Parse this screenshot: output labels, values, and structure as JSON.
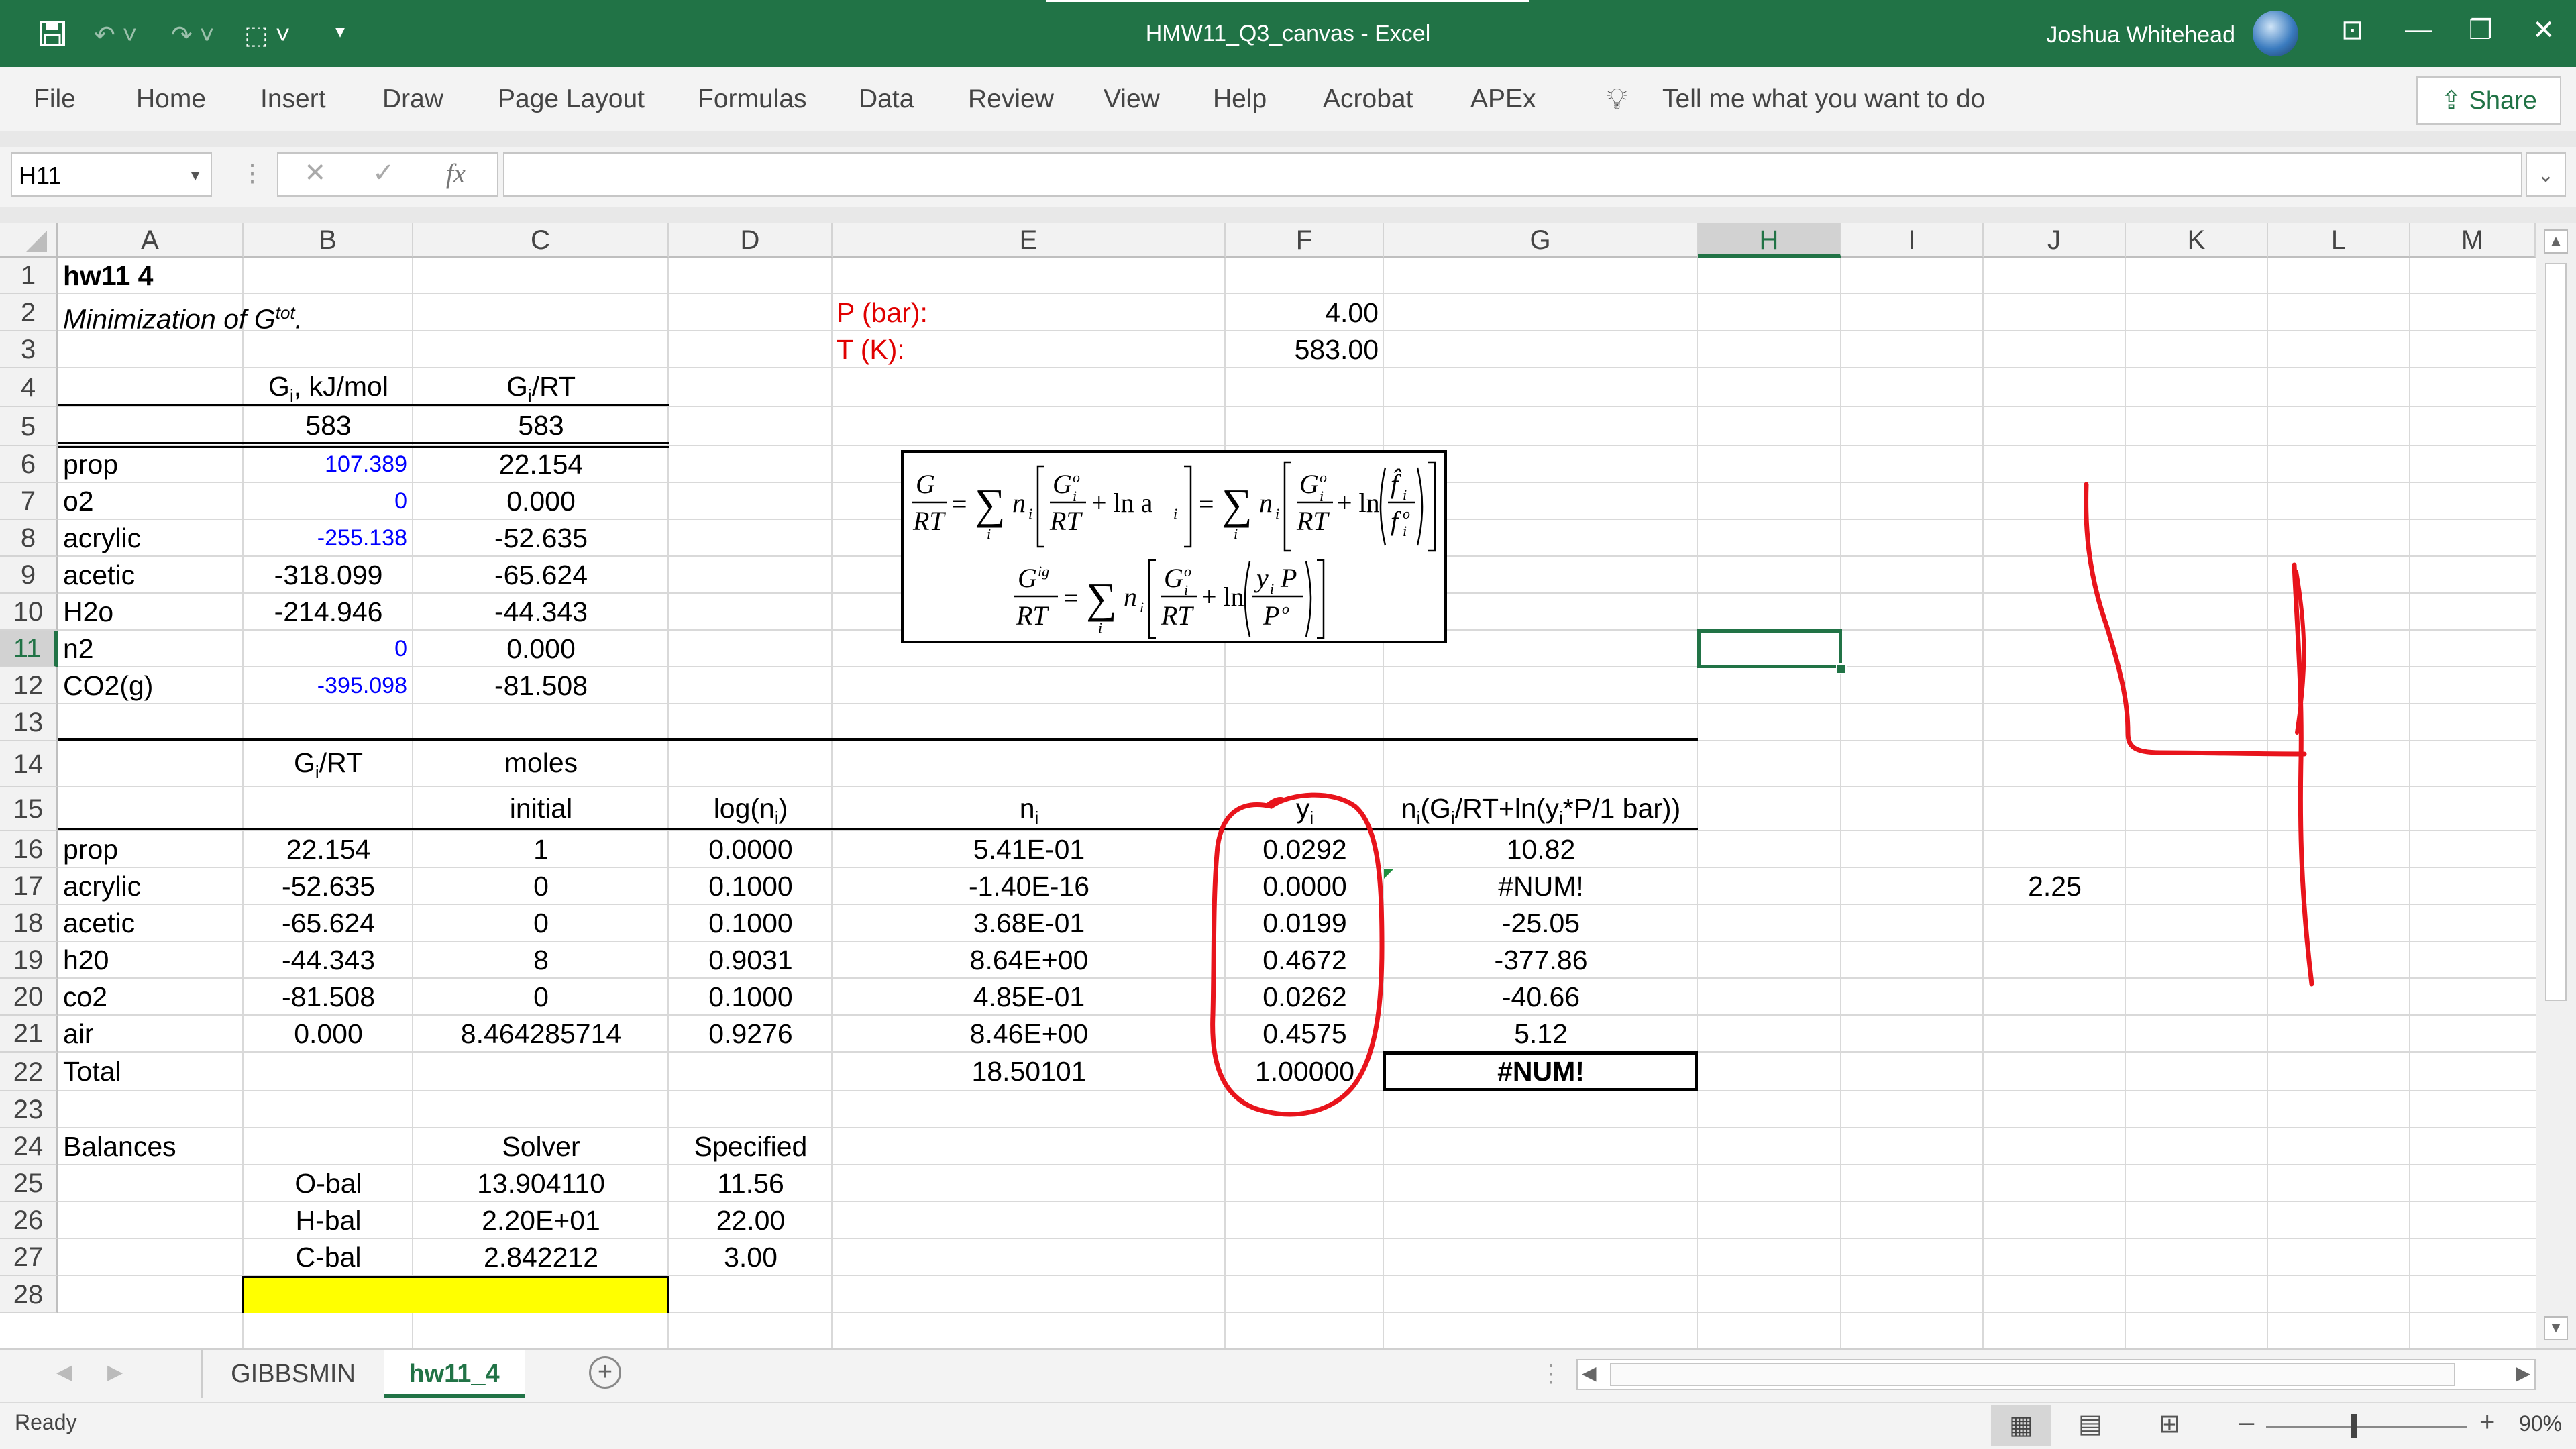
{
  "window": {
    "title": "HMW11_Q3_canvas  -  Excel",
    "user": "Joshua Whitehead",
    "accent": "#217346"
  },
  "ribbon": {
    "tabs": [
      "File",
      "Home",
      "Insert",
      "Draw",
      "Page Layout",
      "Formulas",
      "Data",
      "Review",
      "View",
      "Help",
      "Acrobat",
      "APEx"
    ],
    "tell_me": "Tell me what you want to do",
    "share": "Share"
  },
  "formula_bar": {
    "name_box": "H11",
    "fx": "fx",
    "content": ""
  },
  "columns": [
    "A",
    "B",
    "C",
    "D",
    "E",
    "F",
    "G",
    "H",
    "I",
    "J",
    "K",
    "L",
    "M"
  ],
  "selected_column": "H",
  "rows": [
    "1",
    "2",
    "3",
    "4",
    "5",
    "6",
    "7",
    "8",
    "9",
    "10",
    "11",
    "12",
    "13",
    "14",
    "15",
    "16",
    "17",
    "18",
    "19",
    "20",
    "21",
    "22",
    "23",
    "24",
    "25",
    "26",
    "27",
    "28"
  ],
  "selected_row": "11",
  "sheet": {
    "a1": "hw11 4",
    "a2": "Minimization of G",
    "a2_sup": "tot",
    "a2_tail": ".",
    "e2": "P (bar):",
    "e3": "T (K):",
    "f2": "4.00",
    "f3": "583.00",
    "b4": "G",
    "b4_sub": "i",
    "b4_tail": ", kJ/mol",
    "c4": "G",
    "c4_sub": "i",
    "c4_tail": "/RT",
    "b5": "583",
    "c5": "583",
    "species_table": [
      {
        "name": "prop",
        "g": "107.389",
        "grt": "22.154",
        "blue": true
      },
      {
        "name": "o2",
        "g": "0",
        "grt": "0.000",
        "blue": true
      },
      {
        "name": "acrylic",
        "g": "-255.138",
        "grt": "-52.635",
        "blue": true
      },
      {
        "name": "acetic",
        "g": "-318.099",
        "grt": "-65.624",
        "blue": false
      },
      {
        "name": "H2o",
        "g": "-214.946",
        "grt": "-44.343",
        "blue": false
      },
      {
        "name": "n2",
        "g": "0",
        "grt": "0.000",
        "blue": true
      },
      {
        "name": "CO2(g)",
        "g": "-395.098",
        "grt": "-81.508",
        "blue": true
      }
    ],
    "b14": "G",
    "b14_sub": "i",
    "b14_tail": "/RT",
    "c14": "moles",
    "c15": "initial",
    "d15": "log(n",
    "d15_sub": "i",
    "d15_tail": ")",
    "e15": "n",
    "e15_sub": "i",
    "f15": "y",
    "f15_sub": "i",
    "g15": "n",
    "g15_sub": "i",
    "g15_tail": "(G",
    "g15_sub2": "i",
    "g15_tail2": "/RT+ln(y",
    "g15_sub3": "i",
    "g15_tail3": "*P/1 bar))",
    "calc_table": [
      {
        "name": "prop",
        "grt": "22.154",
        "initial": "1",
        "logn": "0.0000",
        "n": "5.41E-01",
        "y": "0.0292",
        "term": "10.82"
      },
      {
        "name": "acrylic",
        "grt": "-52.635",
        "initial": "0",
        "logn": "0.1000",
        "n": "-1.40E-16",
        "y": "0.0000",
        "term": "#NUM!"
      },
      {
        "name": "acetic",
        "grt": "-65.624",
        "initial": "0",
        "logn": "0.1000",
        "n": "3.68E-01",
        "y": "0.0199",
        "term": "-25.05"
      },
      {
        "name": "h20",
        "grt": "-44.343",
        "initial": "8",
        "logn": "0.9031",
        "n": "8.64E+00",
        "y": "0.4672",
        "term": "-377.86"
      },
      {
        "name": "co2",
        "grt": "-81.508",
        "initial": "0",
        "logn": "0.1000",
        "n": "4.85E-01",
        "y": "0.0262",
        "term": "-40.66"
      },
      {
        "name": "air",
        "grt": "0.000",
        "initial": "8.464285714",
        "logn": "0.9276",
        "n": "8.46E+00",
        "y": "0.4575",
        "term": "5.12"
      }
    ],
    "j17": "2.25",
    "a22": "Total",
    "e22": "18.50101",
    "f22": "1.00000",
    "g22": "#NUM!",
    "a24": "Balances",
    "c24": "Solver",
    "d24": "Specified",
    "balances": [
      {
        "label": "O-bal",
        "solver": "13.904110",
        "specified": "11.56"
      },
      {
        "label": "H-bal",
        "solver": "2.20E+01",
        "specified": "22.00"
      },
      {
        "label": "C-bal",
        "solver": "2.842212",
        "specified": "3.00"
      }
    ],
    "highlight_color": "#ffff00",
    "annotation_color": "#e8141c"
  },
  "equation": {
    "lhs1": "G",
    "rhs_term": "RT",
    "sum": "∑",
    "n": "n",
    "sub_i": "i",
    "ln_a": "+ ln a",
    "ln": "+ ln",
    "g0": "G",
    "g_o": "o",
    "f_hat": "f̂",
    "f_o": "f",
    "gig": "G",
    "ig": "ig",
    "yP": "y",
    "P": "P",
    "Po": "P",
    "eq": "="
  },
  "sheet_tabs": [
    "GIBBSMIN",
    "hw11_4"
  ],
  "active_sheet": "hw11_4",
  "status": {
    "ready": "Ready",
    "zoom": "90%"
  }
}
